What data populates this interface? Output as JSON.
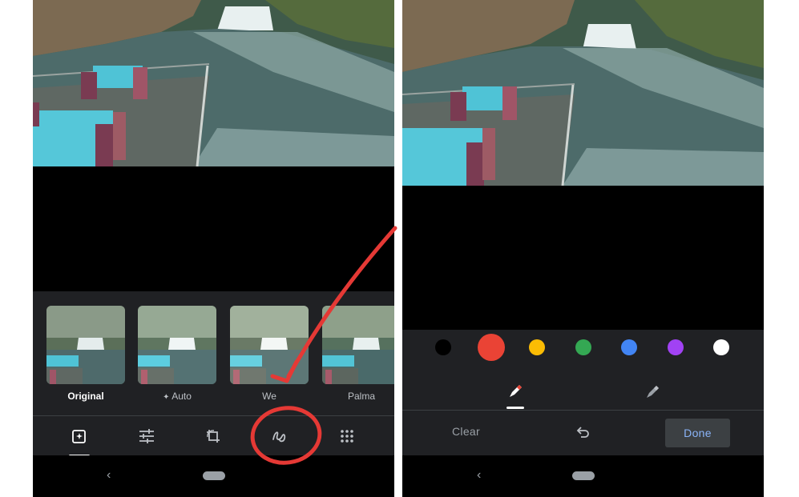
{
  "left_screen": {
    "filters": [
      {
        "label": "Original",
        "active": true
      },
      {
        "label": "Auto",
        "icon": "sparkle-icon"
      },
      {
        "label": "We"
      },
      {
        "label": "Palma"
      }
    ],
    "tools": [
      {
        "name": "suggestions-icon",
        "active": true
      },
      {
        "name": "adjust-icon"
      },
      {
        "name": "crop-rotate-icon"
      },
      {
        "name": "markup-icon"
      },
      {
        "name": "more-icon"
      }
    ],
    "nav": {
      "back": "‹"
    }
  },
  "right_screen": {
    "colors": [
      "#000000",
      "#ea4335",
      "#fbbc04",
      "#34a853",
      "#4285f4",
      "#a142f4",
      "#ffffff"
    ],
    "selected_color": "#ea4335",
    "tools": [
      {
        "name": "pen-icon",
        "active": true
      },
      {
        "name": "highlighter-icon"
      }
    ],
    "actions": {
      "clear": "Clear",
      "done": "Done"
    },
    "nav": {
      "back": "‹"
    }
  },
  "annotation": {
    "color": "#e53935"
  }
}
